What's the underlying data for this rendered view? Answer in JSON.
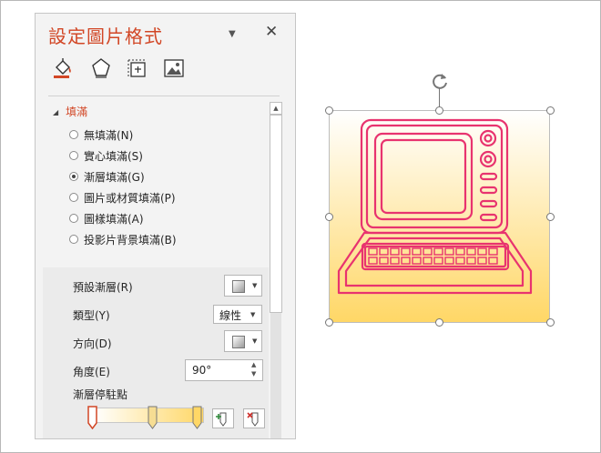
{
  "pane": {
    "title": "設定圖片格式",
    "collapse_glyph": "▼",
    "close_glyph": "✕",
    "tabs": [
      {
        "name": "fill-line",
        "icon": "paint-bucket-icon"
      },
      {
        "name": "effects",
        "icon": "pentagon-icon"
      },
      {
        "name": "size-properties",
        "icon": "size-icon"
      },
      {
        "name": "picture",
        "icon": "picture-icon"
      }
    ],
    "section_title": "填滿",
    "fill_options": [
      {
        "label": "無填滿(N)",
        "selected": false
      },
      {
        "label": "實心填滿(S)",
        "selected": false
      },
      {
        "label": "漸層填滿(G)",
        "selected": true
      },
      {
        "label": "圖片或材質填滿(P)",
        "selected": false
      },
      {
        "label": "圖樣填滿(A)",
        "selected": false
      },
      {
        "label": "投影片背景填滿(B)",
        "selected": false
      }
    ],
    "preset_gradient_label": "預設漸層(R)",
    "type_label": "類型(Y)",
    "type_value": "線性",
    "direction_label": "方向(D)",
    "angle_label": "角度(E)",
    "angle_value": "90°",
    "gradient_stops_label": "漸層停駐點"
  },
  "gradient": {
    "start_color": "#ffffff",
    "end_color": "#ffd766",
    "stop_positions": [
      0,
      0.55,
      0.95
    ]
  },
  "colors": {
    "accent": "#d24726",
    "icon_stroke": "#e8336f"
  }
}
